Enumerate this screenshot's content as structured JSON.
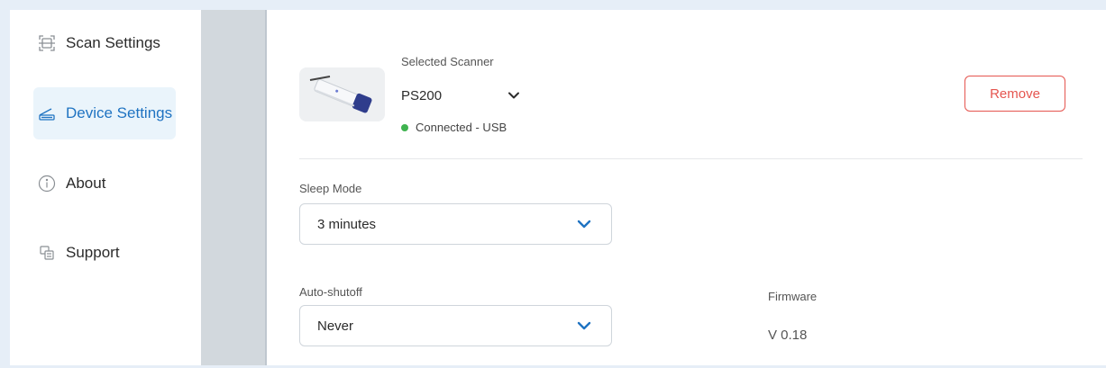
{
  "sidebar": {
    "items": [
      {
        "label": "Scan Settings",
        "icon": "scan-frame-icon",
        "active": false
      },
      {
        "label": "Device Settings",
        "icon": "scanner-icon",
        "active": true
      },
      {
        "label": "About",
        "icon": "info-icon",
        "active": false
      },
      {
        "label": "Support",
        "icon": "support-icon",
        "active": false
      }
    ]
  },
  "device": {
    "selected_label": "Selected Scanner",
    "scanner_name": "PS200",
    "status": "Connected - USB",
    "remove_label": "Remove"
  },
  "settings": {
    "sleep_label": "Sleep Mode",
    "sleep_value": "3 minutes",
    "shutoff_label": "Auto-shutoff",
    "shutoff_value": "Never",
    "firmware_label": "Firmware",
    "firmware_value": "V 0.18"
  },
  "colors": {
    "accent": "#1f73c2",
    "danger": "#e5554f",
    "connected": "#3fb34f",
    "active_bg": "#eaf4fb"
  }
}
